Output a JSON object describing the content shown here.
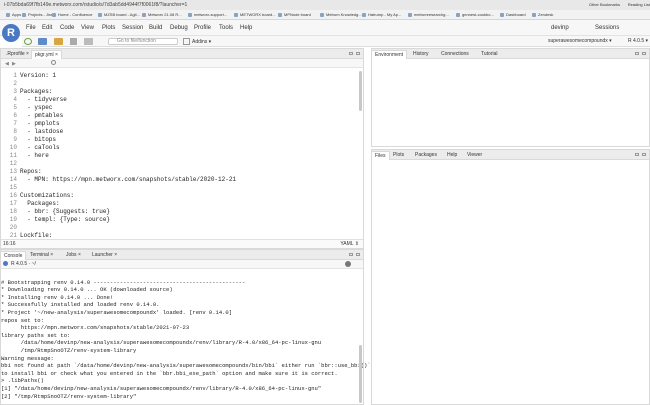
{
  "browser": {
    "url": "i-07b5bda69f7fb149e.metworx.com/rstudio/s/7d3ab5dd4944f7f0061f8/?launcher=1",
    "bookmarks": [
      "Apps",
      "Projects - Jira",
      "Home - Confluence",
      "MZSB board - Agil...",
      "Metworx 21.08 R...",
      "metworx-support...",
      "METWORX board...",
      "MPNode board",
      "Metrum Knowledg...",
      "Hatrump - My Ap...",
      "metrumresearchg...",
      "gennest-cookbo...",
      "Dashboard",
      "Zendesk"
    ],
    "other_bookmarks": "Other Bookmarks",
    "reading_list": "Reading List"
  },
  "app": {
    "logo": "R",
    "menu": [
      "File",
      "Edit",
      "Code",
      "View",
      "Plots",
      "Session",
      "Build",
      "Debug",
      "Profile",
      "Tools",
      "Help"
    ],
    "user": "devinp",
    "sessions": "Sessions",
    "goto_placeholder": "Go to file/function",
    "addins": "Addins",
    "project": "superawesomecompoundx",
    "r_version": "R 4.0.5"
  },
  "editor": {
    "tabs": [
      ".Rprofile",
      "pkgr.yml"
    ],
    "cursor": "16:16",
    "filetype": "YAML",
    "line_numbers": [
      "1",
      "2",
      "3",
      "4",
      "5",
      "6",
      "7",
      "8",
      "9",
      "10",
      "11",
      "12",
      "13",
      "14",
      "15",
      "16",
      "17",
      "18",
      "19",
      "20",
      "21",
      "22"
    ],
    "lines": [
      "Version: 1",
      "",
      "Packages:",
      "  - tidyverse",
      "  - yspec",
      "  - pmtables",
      "  - pmplots",
      "  - lastdose",
      "  - bitops",
      "  - caTools",
      "  - here",
      "",
      "Repos:",
      "  - MPN: https://mpn.metworx.com/snapshots/stable/2020-12-21",
      "",
      "Customizations:",
      "  Packages:",
      "  - bbr: {Suggests: true}",
      "  - templ: {Type: source}",
      "",
      "Lockfile:",
      "    Type: renv"
    ]
  },
  "console": {
    "tabs": [
      "Console",
      "Terminal",
      "Jobs",
      "Launcher"
    ],
    "version_path": "R 4.0.5 · ~/",
    "lines": [
      "",
      "# Bootstrapping renv 0.14.0 ----------------------------------------------",
      "* Downloading renv 0.14.0 ... OK (downloaded source)",
      "* Installing renv 0.14.0 ... Done!",
      "* Successfully installed and loaded renv 0.14.0.",
      "* Project '~/new-analysis/superawesomecompoundx' loaded. [renv 0.14.0]",
      "repos set to:",
      "      https://mpn.metworx.com/snapshots/stable/2021-07-23",
      "library paths set to:",
      "      /data/home/devinp/new-analysis/superawesomecompoundx/renv/library/R-4.0/x86_64-pc-linux-gnu",
      "      /tmp/RtmpSnoOTZ/renv-system-library",
      "Warning message:",
      "bbi not found at path `/data/home/devinp/new-analysis/superawesomecompoundx/bin/bbi` either run `bbr::use_bbi()`",
      "to install bbi or check what you entered in the `bbr.bbi_exe_path` option and make sure it is correct.",
      "> .libPaths()",
      "[1] \"/data/home/devinp/new-analysis/superawesomecompoundx/renv/library/R-4.0/x86_64-pc-linux-gnu\"",
      "[2] \"/tmp/RtmpSnoOTZ/renv-system-library\""
    ]
  },
  "env_tabs": [
    "Environment",
    "History",
    "Connections",
    "Tutorial"
  ],
  "files_tabs": [
    "Files",
    "Plots",
    "Packages",
    "Help",
    "Viewer"
  ]
}
